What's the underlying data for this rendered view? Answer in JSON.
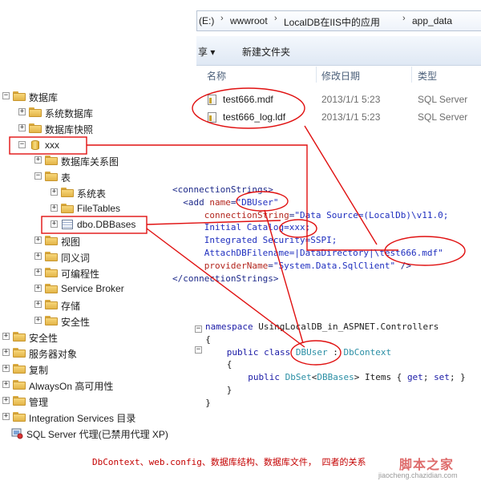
{
  "explorer": {
    "breadcrumb": [
      "(E:)",
      "wwwroot",
      "LocalDB在IIS中的应用",
      "app_data"
    ],
    "toolbar": {
      "share": "享 ▾",
      "new_folder": "新建文件夹"
    },
    "columns": {
      "name": "名称",
      "modified": "修改日期",
      "type": "类型"
    },
    "files": [
      {
        "name": "test666.mdf",
        "modified": "2013/1/1 5:23",
        "type": "SQL Server"
      },
      {
        "name": "test666_log.ldf",
        "modified": "2013/1/1 5:23",
        "type": "SQL Server"
      }
    ]
  },
  "tree": {
    "nodes": [
      {
        "label": "数据库",
        "expander": "−",
        "icon": "folder-icon"
      },
      {
        "label": "系统数据库",
        "expander": "+",
        "icon": "folder-icon"
      },
      {
        "label": "数据库快照",
        "expander": "+",
        "icon": "folder-icon"
      },
      {
        "label": "xxx",
        "expander": "−",
        "icon": "database-icon"
      },
      {
        "label": "数据库关系图",
        "expander": "+",
        "icon": "folder-icon"
      },
      {
        "label": "表",
        "expander": "−",
        "icon": "folder-icon"
      },
      {
        "label": "系统表",
        "expander": "+",
        "icon": "folder-icon"
      },
      {
        "label": "FileTables",
        "expander": "+",
        "icon": "folder-icon"
      },
      {
        "label": "dbo.DBBases",
        "expander": "+",
        "icon": "table-icon"
      },
      {
        "label": "视图",
        "expander": "+",
        "icon": "folder-icon"
      },
      {
        "label": "同义词",
        "expander": "+",
        "icon": "folder-icon"
      },
      {
        "label": "可编程性",
        "expander": "+",
        "icon": "folder-icon"
      },
      {
        "label": "Service Broker",
        "expander": "+",
        "icon": "folder-icon"
      },
      {
        "label": "存储",
        "expander": "+",
        "icon": "folder-icon"
      },
      {
        "label": "安全性",
        "expander": "+",
        "icon": "folder-icon"
      },
      {
        "label": "安全性",
        "expander": "+",
        "icon": "folder-icon"
      },
      {
        "label": "服务器对象",
        "expander": "+",
        "icon": "folder-icon"
      },
      {
        "label": "复制",
        "expander": "+",
        "icon": "folder-icon"
      },
      {
        "label": "AlwaysOn 高可用性",
        "expander": "+",
        "icon": "folder-icon"
      },
      {
        "label": "管理",
        "expander": "+",
        "icon": "folder-icon"
      },
      {
        "label": "Integration Services 目录",
        "expander": "+",
        "icon": "folder-icon"
      },
      {
        "label": "SQL Server 代理(已禁用代理 XP)",
        "expander": "",
        "icon": "agent-icon"
      }
    ]
  },
  "config_code": {
    "l1_open": "<connectionStrings>",
    "l2_a": "<add ",
    "l2_attr": "name",
    "l2_eq": "=",
    "l2_val": "\"DBUser\"",
    "l3_attr": "connectionString",
    "l3_eq": "=",
    "l3_val": "\"Data Source=(LocalDb)\\v11.0;",
    "l4": "Initial Catalog=xxx;",
    "l5": "Integrated Security=SSPI;",
    "l6_a": "AttachDBFilename=|DataDirectory|",
    "l6_b": "\\test666.mdf\"",
    "l7_attr": "providerName",
    "l7_eq": "=",
    "l7_val": "\"System.Data.SqlClient\"",
    "l7_close": " />",
    "l8_close": "</connectionStrings>"
  },
  "cs_code": {
    "ns_kw": "namespace",
    "ns_name": " UsingLocalDB_in_ASPNET.Controllers",
    "brace_open": "{",
    "cls_kw": "public class ",
    "cls_name": "DBUser",
    "cls_colon": " : ",
    "cls_base": "DbContext",
    "inner_open": "{",
    "prop_kw": "public ",
    "prop_type": "DbSet",
    "prop_lt": "<",
    "prop_generic": "DBBases",
    "prop_rest_a": "> Items { ",
    "prop_get": "get",
    "prop_mid": "; ",
    "prop_set": "set",
    "prop_end": "; }",
    "inner_close": "}",
    "brace_close": "}"
  },
  "caption": "DbContext、web.config、数据库结构、数据库文件， 四者的关系",
  "watermark": "脚本之家",
  "watermark_url": "jiaocheng.chazidian.com",
  "colors": {
    "annotation": "#e01010",
    "caption": "#c40000"
  }
}
